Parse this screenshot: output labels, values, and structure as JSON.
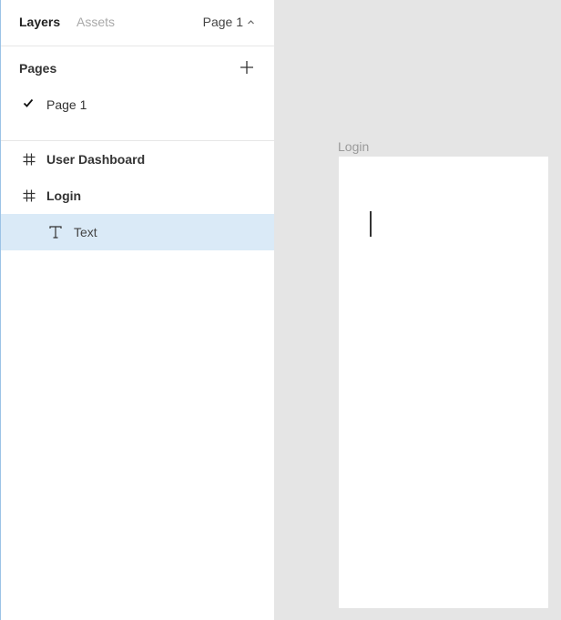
{
  "panel": {
    "tabs": [
      {
        "label": "Layers",
        "active": true
      },
      {
        "label": "Assets",
        "active": false
      }
    ],
    "current_page_label": "Page 1"
  },
  "pages": {
    "title": "Pages",
    "items": [
      {
        "label": "Page 1",
        "selected": true
      }
    ]
  },
  "layers": {
    "items": [
      {
        "label": "User Dashboard",
        "type": "frame",
        "icon": "frame-hash-icon"
      },
      {
        "label": "Login",
        "type": "frame",
        "icon": "frame-hash-icon"
      },
      {
        "label": "Text",
        "type": "text",
        "icon": "text-type-icon",
        "selected": true
      }
    ]
  },
  "canvas": {
    "frame_label": "Login",
    "background": "#e5e5e5",
    "selection_color": "#daeaf7"
  }
}
